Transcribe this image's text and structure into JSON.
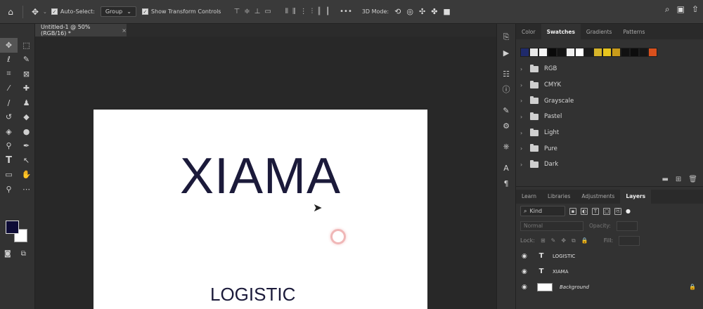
{
  "options_bar": {
    "auto_select_label": "Auto-Select:",
    "auto_select_value": "Group",
    "show_transform_label": "Show Transform Controls",
    "more_label": "•••",
    "mode_3d_label": "3D Mode:"
  },
  "document": {
    "tab_title": "Untitled-1 @ 50% (RGB/16) *",
    "close_glyph": "×"
  },
  "canvas": {
    "title_text": "XIAMA",
    "subtitle_text": "LOGISTIC"
  },
  "color_panel": {
    "tabs": [
      "Color",
      "Swatches",
      "Gradients",
      "Patterns"
    ],
    "active_tab": "Swatches",
    "swatch_colors": [
      "#1f2a6b",
      "#e8e8e8",
      "#f5f5f5",
      "#0a0a0a",
      "#141414",
      "#f0f0f0",
      "#ffffff",
      "#1a1a1a",
      "#d6b42a",
      "#e8c51e",
      "#c89b1a",
      "#111111",
      "#0d0d0d",
      "#151515",
      "#d9501c"
    ],
    "folders": [
      "RGB",
      "CMYK",
      "Grayscale",
      "Pastel",
      "Light",
      "Pure",
      "Dark"
    ]
  },
  "layers_panel": {
    "tabs": [
      "Learn",
      "Libraries",
      "Adjustments",
      "Layers"
    ],
    "active_tab": "Layers",
    "filter_kind": "Kind",
    "blend_mode": "Normal",
    "opacity_label": "Opacity:",
    "lock_label": "Lock:",
    "fill_label": "Fill:",
    "layers": [
      {
        "name": "LOGISTIC",
        "type": "text"
      },
      {
        "name": "XIAMA",
        "type": "text"
      },
      {
        "name": "Background",
        "type": "image",
        "locked": true
      }
    ]
  },
  "colors": {
    "foreground": "#0e0c36",
    "background": "#ffffff",
    "accent_ui": "#3a3a3a"
  }
}
